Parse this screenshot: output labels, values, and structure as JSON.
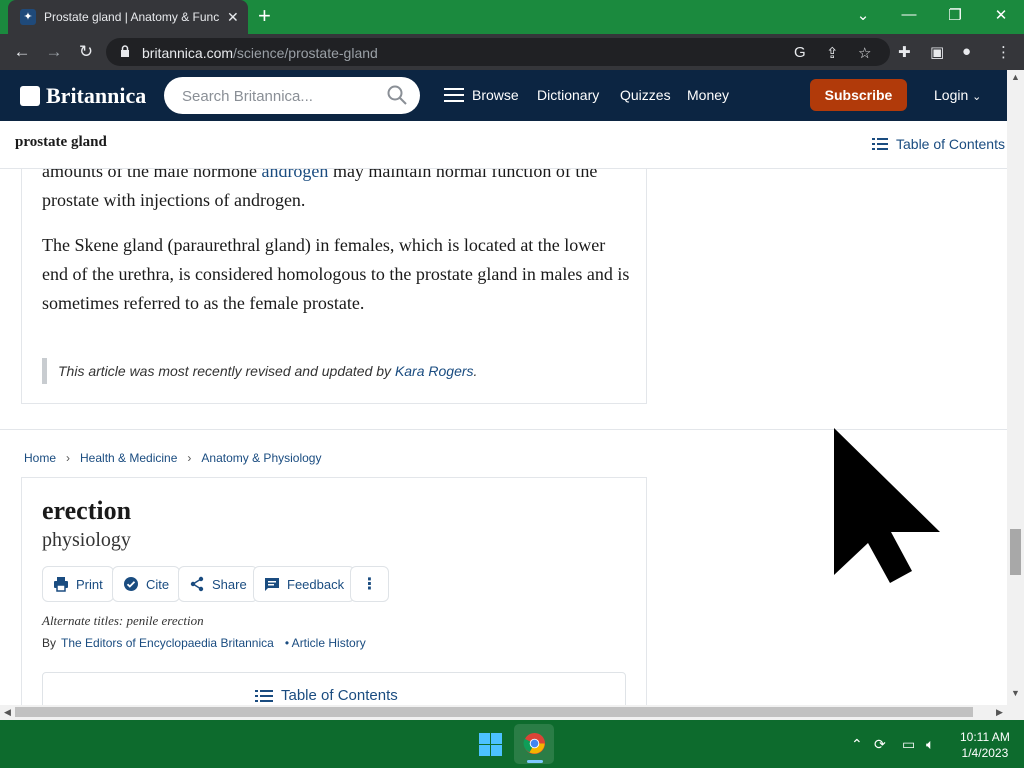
{
  "browser": {
    "tab_title": "Prostate gland | Anatomy & Func",
    "url_host": "britannica.com",
    "url_path": "/science/prostate-gland"
  },
  "header": {
    "logo_text": "Britannica",
    "search_placeholder": "Search Britannica...",
    "nav": [
      "Browse",
      "Dictionary",
      "Quizzes",
      "Money"
    ],
    "subscribe_label": "Subscribe",
    "login_label": "Login"
  },
  "sticky": {
    "article_title": "prostate gland",
    "toc_label": "Table of Contents"
  },
  "article1": {
    "para1_pre": "amounts of the male hormone ",
    "para1_link": "androgen",
    "para1_post": " may maintain normal function of the prostate with injections of androgen.",
    "para2": "The Skene gland (paraurethral gland) in females, which is located at the lower end of the urethra, is considered homologous to the prostate gland in males and is sometimes referred to as the female prostate.",
    "revised_text": "This article was most recently revised and updated by ",
    "revised_author": "Kara Rogers",
    "revised_end": "."
  },
  "breadcrumb": [
    "Home",
    "Health & Medicine",
    "Anatomy & Physiology"
  ],
  "article2": {
    "title": "erection",
    "subtitle": "physiology",
    "actions": {
      "print": "Print",
      "cite": "Cite",
      "share": "Share",
      "feedback": "Feedback"
    },
    "alt_titles": "Alternate titles: penile erection",
    "by": "By",
    "author": "The Editors of Encyclopaedia Britannica",
    "history": "• Article History",
    "toc_label": "Table of Contents"
  },
  "taskbar": {
    "time": "10:11 AM",
    "date": "1/4/2023"
  },
  "colors": {
    "header_bg": "#0c2542",
    "subscribe_bg": "#b13a0a",
    "link": "#1a4c80",
    "titlebar_bg": "#1b8a3e"
  }
}
